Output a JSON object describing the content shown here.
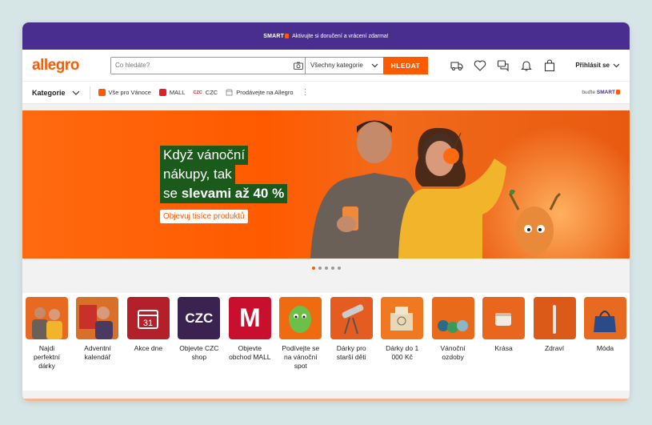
{
  "promo": {
    "brand": "SMART",
    "text": "Aktivujte si doručení a vrácení zdarma!"
  },
  "header": {
    "logo": "allegro",
    "search_placeholder": "Co hledáte?",
    "category_select": "Všechny kategorie",
    "search_button": "HLEDAT",
    "login": "Přihlásit se"
  },
  "nav": {
    "categories": "Kategorie",
    "items": [
      {
        "label": "Vše pro Vánoce",
        "color": "#ff5a00"
      },
      {
        "label": "MALL",
        "color": "#e0202a"
      },
      {
        "label": "CZC",
        "color": "#e0202a"
      },
      {
        "label": "Prodávejte na Allegro",
        "color": "#999999"
      }
    ],
    "smart_prefix": "buďte",
    "smart_brand": "SMART"
  },
  "banner": {
    "line1": "Když vánoční",
    "line2": "nákupy, tak",
    "line3_plain": "se ",
    "line3_bold": "slevami až 40 %",
    "cta": "Objevuj tisíce produktů"
  },
  "carousel": {
    "total": 5,
    "active": 1
  },
  "categories": [
    {
      "label": "Najdi perfektní dárky",
      "bg": "#e86a20"
    },
    {
      "label": "Adventní kalendář",
      "bg": "#d8702a"
    },
    {
      "label": "Akce dne",
      "bg": "#b3202a",
      "glyph": "31"
    },
    {
      "label": "Objevte CZC shop",
      "bg": "#3a2350",
      "glyph": "CZC"
    },
    {
      "label": "Objevte obchod MALL",
      "bg": "#c8102e",
      "glyph": "M"
    },
    {
      "label": "Podívejte se na vánoční spot",
      "bg": "#f06a10"
    },
    {
      "label": "Dárky pro starší děti",
      "bg": "#e45c20"
    },
    {
      "label": "Dárky do 1 000 Kč",
      "bg": "#f07820"
    },
    {
      "label": "Vánoční ozdoby",
      "bg": "#e86a1a"
    },
    {
      "label": "Krása",
      "bg": "#e8661e"
    },
    {
      "label": "Zdraví",
      "bg": "#dc5a18"
    },
    {
      "label": "Móda",
      "bg": "#e86a20"
    }
  ]
}
